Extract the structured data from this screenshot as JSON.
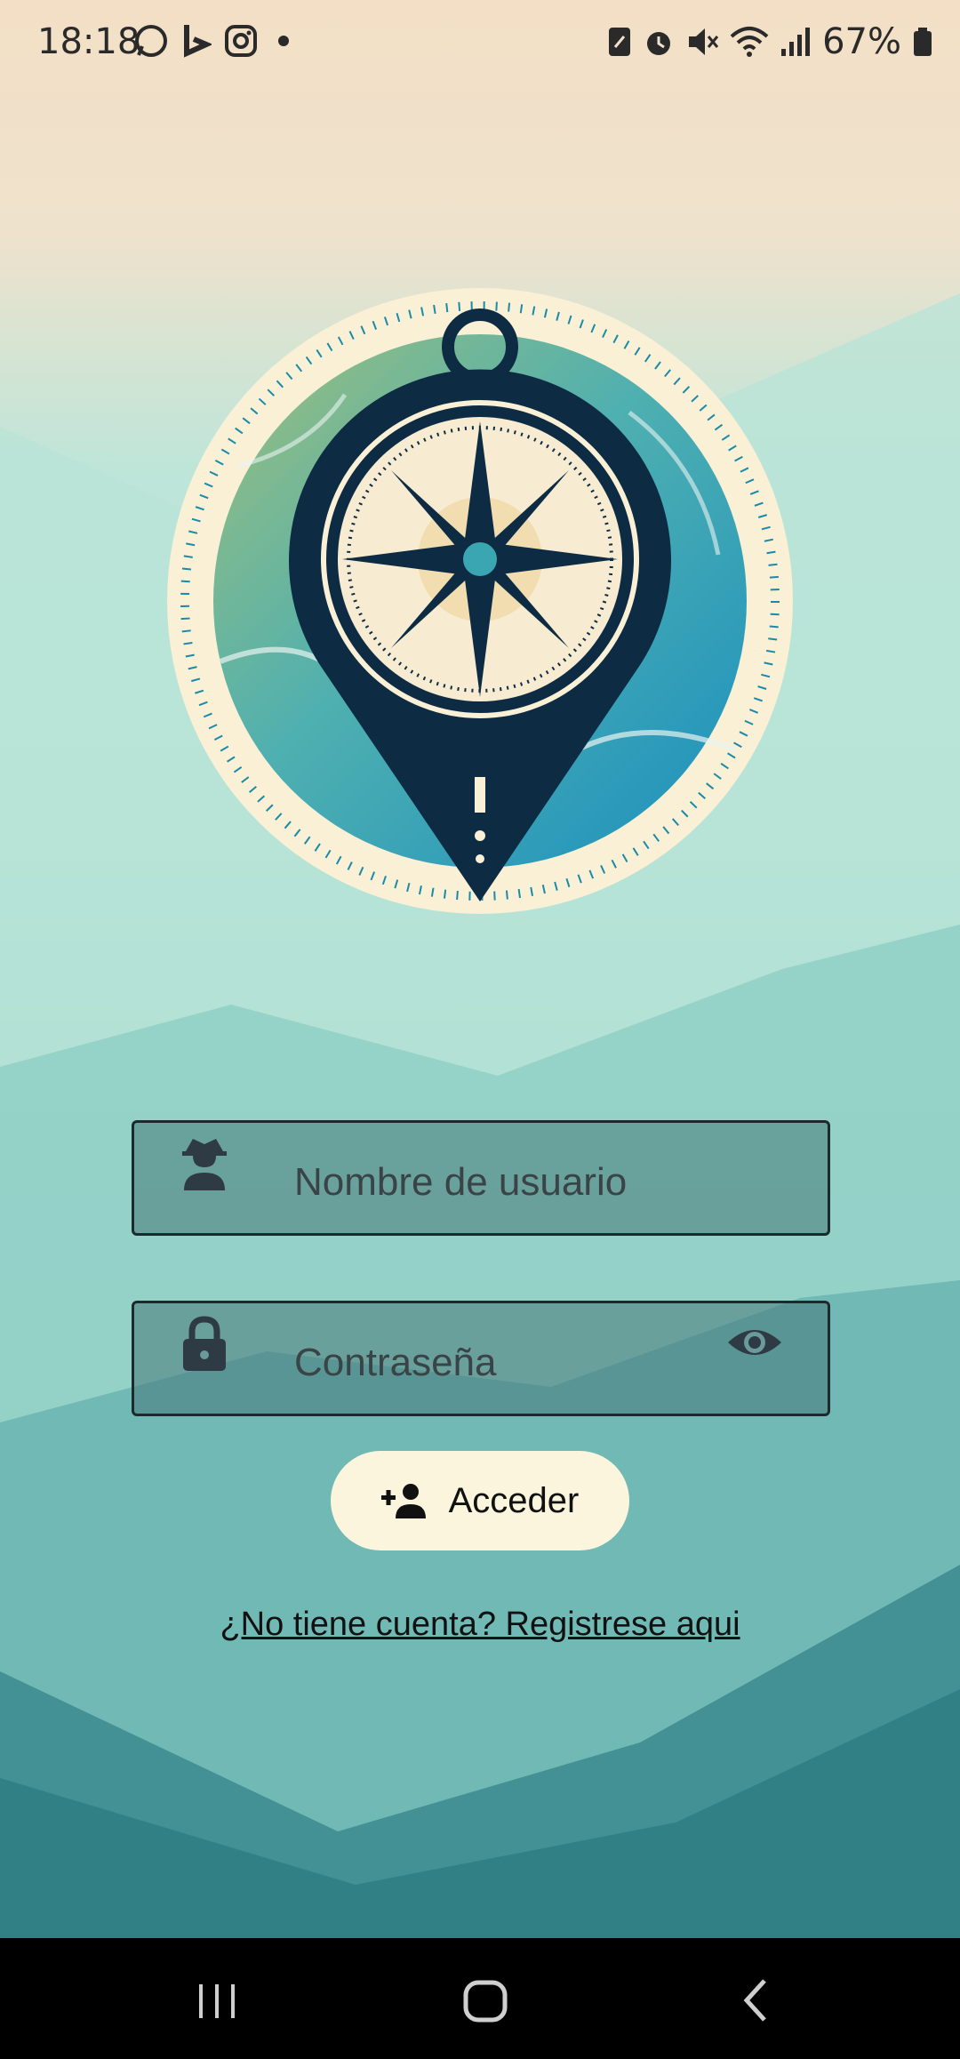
{
  "status_bar": {
    "time": "18:18",
    "left_icons": [
      "whatsapp-icon",
      "bing-icon",
      "instagram-icon",
      "dot-icon"
    ],
    "right_icons": [
      "nfc-icon",
      "alarm-icon",
      "mute-icon",
      "wifi-icon",
      "signal-icon"
    ],
    "battery": "67%"
  },
  "logo": {
    "icon": "compass-map-pin-logo"
  },
  "form": {
    "username": {
      "placeholder": "Nombre de usuario",
      "icon": "user-hat-icon"
    },
    "password": {
      "placeholder": "Contraseña",
      "icon": "lock-icon",
      "toggle_icon": "eye-icon"
    },
    "submit": {
      "label": "Acceder",
      "icon": "person-add-icon"
    },
    "register_link": "¿No tiene cuenta? Registrese aqui"
  },
  "nav_bar": {
    "items": [
      "recent-apps-icon",
      "home-icon",
      "back-icon"
    ]
  },
  "colors": {
    "button_bg": "#fbf5dd",
    "field_bg": "#467878",
    "compass_dark": "#0e2b44",
    "compass_teal": "#1e8fb0"
  }
}
